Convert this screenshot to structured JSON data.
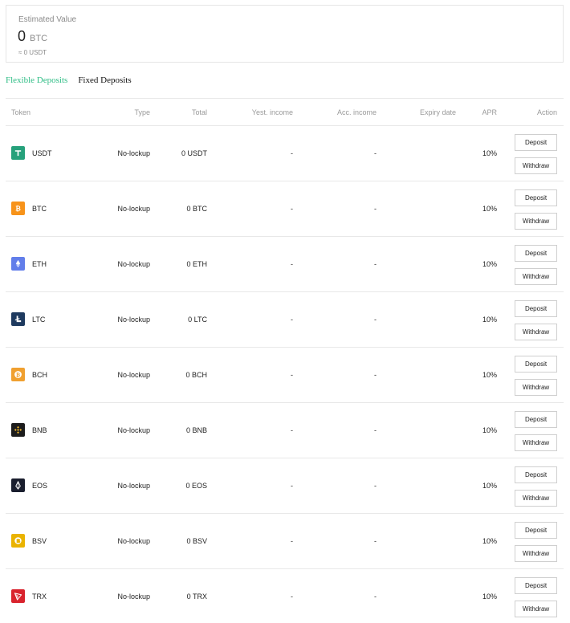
{
  "summary": {
    "label": "Estimated Value",
    "value": "0",
    "unit": "BTC",
    "approx": "≈ 0 USDT"
  },
  "tabs": [
    {
      "label": "Flexible Deposits",
      "active": true
    },
    {
      "label": "Fixed Deposits",
      "active": false
    }
  ],
  "table": {
    "headers": {
      "token": "Token",
      "type": "Type",
      "total": "Total",
      "yest_income": "Yest. income",
      "acc_income": "Acc. income",
      "expiry_date": "Expiry date",
      "apr": "APR",
      "action": "Action"
    },
    "rows": [
      {
        "token": "USDT",
        "icon": "usdt-icon",
        "color": "#26a17b",
        "type": "No-lockup",
        "total": "0 USDT",
        "yest_income": "-",
        "acc_income": "-",
        "apr": "10%",
        "deposit": "Deposit",
        "withdraw": "Withdraw"
      },
      {
        "token": "BTC",
        "icon": "btc-icon",
        "color": "#f7931a",
        "type": "No-lockup",
        "total": "0 BTC",
        "yest_income": "-",
        "acc_income": "-",
        "apr": "10%",
        "deposit": "Deposit",
        "withdraw": "Withdraw"
      },
      {
        "token": "ETH",
        "icon": "eth-icon",
        "color": "#627eea",
        "type": "No-lockup",
        "total": "0 ETH",
        "yest_income": "-",
        "acc_income": "-",
        "apr": "10%",
        "deposit": "Deposit",
        "withdraw": "Withdraw"
      },
      {
        "token": "LTC",
        "icon": "ltc-icon",
        "color": "#1e3a5f",
        "type": "No-lockup",
        "total": "0 LTC",
        "yest_income": "-",
        "acc_income": "-",
        "apr": "10%",
        "deposit": "Deposit",
        "withdraw": "Withdraw"
      },
      {
        "token": "BCH",
        "icon": "bch-icon",
        "color": "#f0a030",
        "type": "No-lockup",
        "total": "0 BCH",
        "yest_income": "-",
        "acc_income": "-",
        "apr": "10%",
        "deposit": "Deposit",
        "withdraw": "Withdraw"
      },
      {
        "token": "BNB",
        "icon": "bnb-icon",
        "color": "#1c1c1c",
        "type": "No-lockup",
        "total": "0 BNB",
        "yest_income": "-",
        "acc_income": "-",
        "apr": "10%",
        "deposit": "Deposit",
        "withdraw": "Withdraw"
      },
      {
        "token": "EOS",
        "icon": "eos-icon",
        "color": "#1a1e2e",
        "type": "No-lockup",
        "total": "0 EOS",
        "yest_income": "-",
        "acc_income": "-",
        "apr": "10%",
        "deposit": "Deposit",
        "withdraw": "Withdraw"
      },
      {
        "token": "BSV",
        "icon": "bsv-icon",
        "color": "#eab300",
        "type": "No-lockup",
        "total": "0 BSV",
        "yest_income": "-",
        "acc_income": "-",
        "apr": "10%",
        "deposit": "Deposit",
        "withdraw": "Withdraw"
      },
      {
        "token": "TRX",
        "icon": "trx-icon",
        "color": "#d9232d",
        "type": "No-lockup",
        "total": "0 TRX",
        "yest_income": "-",
        "acc_income": "-",
        "apr": "10%",
        "deposit": "Deposit",
        "withdraw": "Withdraw"
      }
    ]
  }
}
